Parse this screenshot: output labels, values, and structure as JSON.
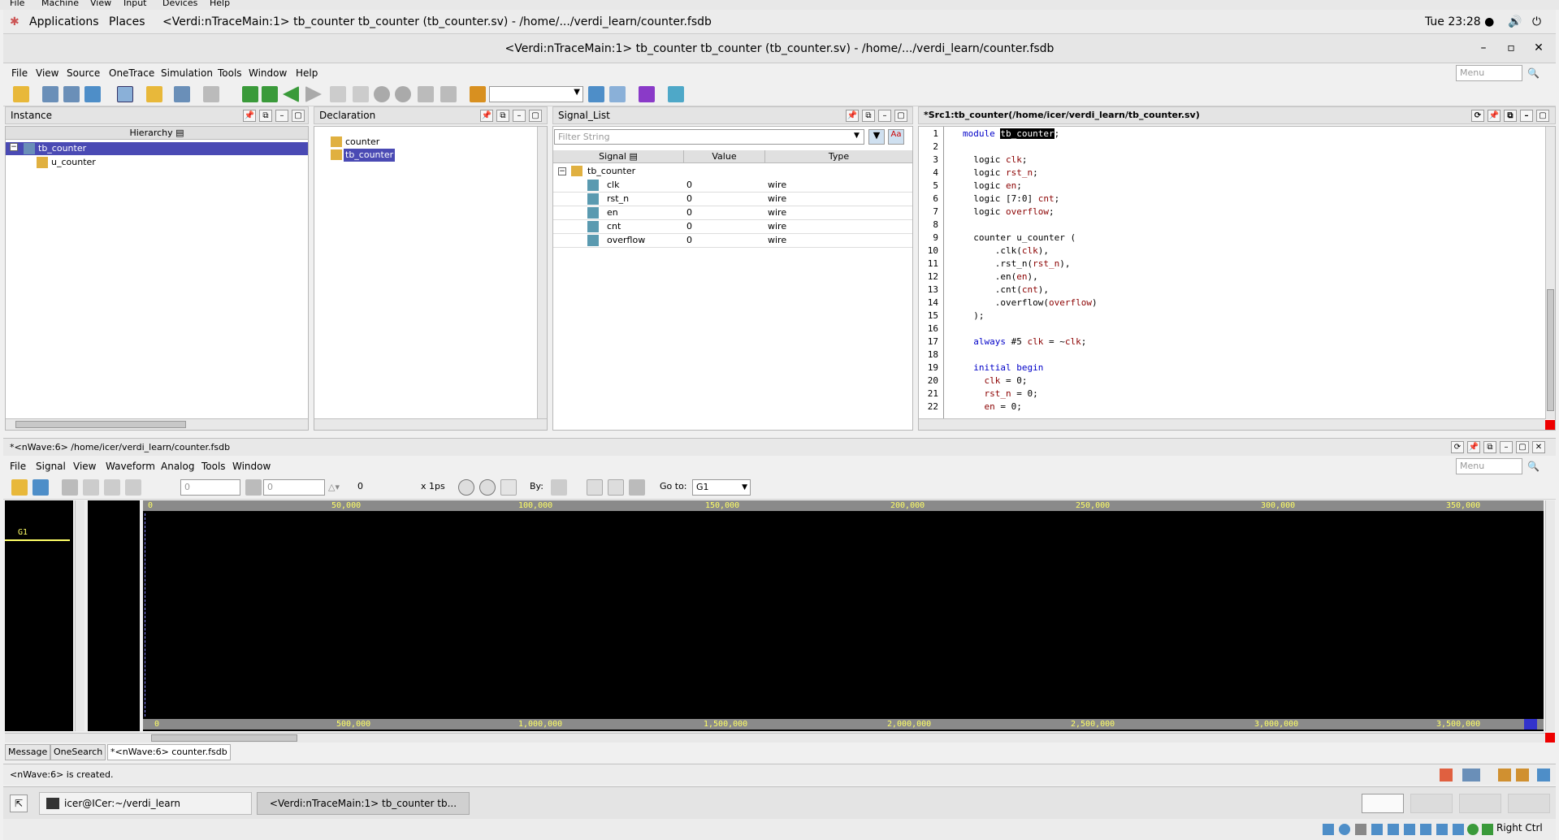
{
  "vm_menu": [
    "File",
    "Machine",
    "View",
    "Input",
    "Devices",
    "Help"
  ],
  "gnome": {
    "applications": "Applications",
    "places": "Places",
    "window_title": "<Verdi:nTraceMain:1> tb_counter tb_counter (tb_counter.sv) - /home/.../verdi_learn/counter.fsdb",
    "clock": "Tue 23:28 ●"
  },
  "title_bar": "<Verdi:nTraceMain:1> tb_counter tb_counter (tb_counter.sv) - /home/.../verdi_learn/counter.fsdb",
  "main_menu": [
    "File",
    "View",
    "Source",
    "OneTrace",
    "Simulation",
    "Tools",
    "Window",
    "Help"
  ],
  "menu_search_placeholder": "Menu",
  "instance": {
    "title": "Instance",
    "col": "Hierarchy",
    "items": [
      "tb_counter",
      "u_counter"
    ]
  },
  "declaration": {
    "title": "Declaration",
    "items": [
      "counter",
      "tb_counter"
    ]
  },
  "signal_list": {
    "title": "Signal_List",
    "filter_placeholder": "Filter String",
    "cols": [
      "Signal",
      "Value",
      "Type"
    ],
    "group": "tb_counter",
    "rows": [
      {
        "name": "clk",
        "value": "0",
        "type": "wire"
      },
      {
        "name": "rst_n",
        "value": "0",
        "type": "wire"
      },
      {
        "name": "en",
        "value": "0",
        "type": "wire"
      },
      {
        "name": "cnt",
        "value": "0",
        "type": "wire"
      },
      {
        "name": "overflow",
        "value": "0",
        "type": "wire"
      }
    ]
  },
  "source": {
    "title": "*Src1:tb_counter(/home/icer/verdi_learn/tb_counter.sv)",
    "lines": [
      "module tb_counter;",
      "",
      "  logic clk;",
      "  logic rst_n;",
      "  logic en;",
      "  logic [7:0] cnt;",
      "  logic overflow;",
      "",
      "  counter u_counter (",
      "      .clk(clk),",
      "      .rst_n(rst_n),",
      "      .en(en),",
      "      .cnt(cnt),",
      "      .overflow(overflow)",
      "  );",
      "",
      "  always #5 clk = ~clk;",
      "",
      "  initial begin",
      "    clk = 0;",
      "    rst_n = 0;",
      "    en = 0;"
    ]
  },
  "nwave": {
    "title": "*<nWave:6> /home/icer/verdi_learn/counter.fsdb",
    "menu": [
      "File",
      "Signal",
      "View",
      "Waveform",
      "Analog",
      "Tools",
      "Window"
    ],
    "cursor_val": "0",
    "marker_val": "0",
    "delta": "0",
    "unit": "x 1ps",
    "by_label": "By:",
    "goto_label": "Go to:",
    "goto_value": "G1",
    "group": "G1",
    "top_ruler": [
      "0",
      "50,000",
      "100,000",
      "150,000",
      "200,000",
      "250,000",
      "300,000",
      "350,000"
    ],
    "bottom_ruler": [
      "0",
      "500,000",
      "1,000,000",
      "1,500,000",
      "2,000,000",
      "2,500,000",
      "3,000,000",
      "3,500,000"
    ]
  },
  "bottom_tabs": [
    "Message",
    "OneSearch",
    "*<nWave:6> counter.fsdb"
  ],
  "status_msg": "<nWave:6> is created.",
  "taskbar": {
    "terminal": "icer@ICer:~/verdi_learn",
    "verdi": "<Verdi:nTraceMain:1> tb_counter tb..."
  },
  "host_key": "Right Ctrl"
}
